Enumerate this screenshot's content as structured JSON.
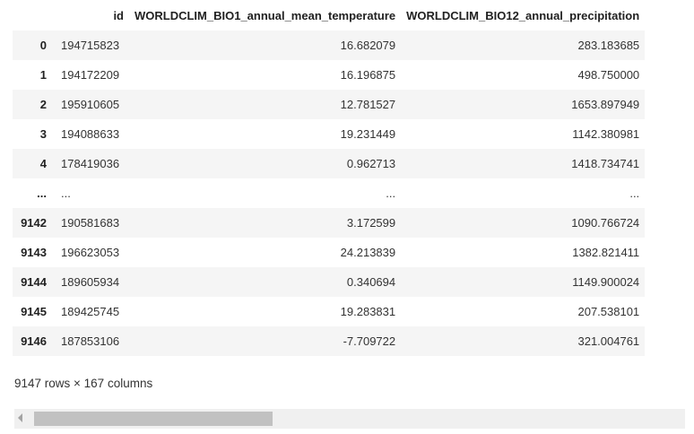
{
  "table": {
    "columns": [
      "",
      "id",
      "WORLDCLIM_BIO1_annual_mean_temperature",
      "WORLDCLIM_BIO12_annual_precipitation"
    ],
    "rows": [
      {
        "index": "0",
        "id": "194715823",
        "bio1": "16.682079",
        "bio12": "283.183685"
      },
      {
        "index": "1",
        "id": "194172209",
        "bio1": "16.196875",
        "bio12": "498.750000"
      },
      {
        "index": "2",
        "id": "195910605",
        "bio1": "12.781527",
        "bio12": "1653.897949"
      },
      {
        "index": "3",
        "id": "194088633",
        "bio1": "19.231449",
        "bio12": "1142.380981"
      },
      {
        "index": "4",
        "id": "178419036",
        "bio1": "0.962713",
        "bio12": "1418.734741"
      },
      {
        "index": "...",
        "id": "...",
        "bio1": "...",
        "bio12": "..."
      },
      {
        "index": "9142",
        "id": "190581683",
        "bio1": "3.172599",
        "bio12": "1090.766724"
      },
      {
        "index": "9143",
        "id": "196623053",
        "bio1": "24.213839",
        "bio12": "1382.821411"
      },
      {
        "index": "9144",
        "id": "189605934",
        "bio1": "0.340694",
        "bio12": "1149.900024"
      },
      {
        "index": "9145",
        "id": "189425745",
        "bio1": "19.283831",
        "bio12": "207.538101"
      },
      {
        "index": "9146",
        "id": "187853106",
        "bio1": "-7.709722",
        "bio12": "321.004761"
      }
    ]
  },
  "caption": "9147 rows × 167 columns",
  "scrollbar": {
    "left_arrow_icon": "chevron-left-icon",
    "colors": {
      "track": "#f0f0f0",
      "thumb": "#c1c1c1",
      "arrow": "#a3a3a3"
    }
  },
  "colors": {
    "row_stripe": "#f5f5f5",
    "text": "#212121"
  }
}
